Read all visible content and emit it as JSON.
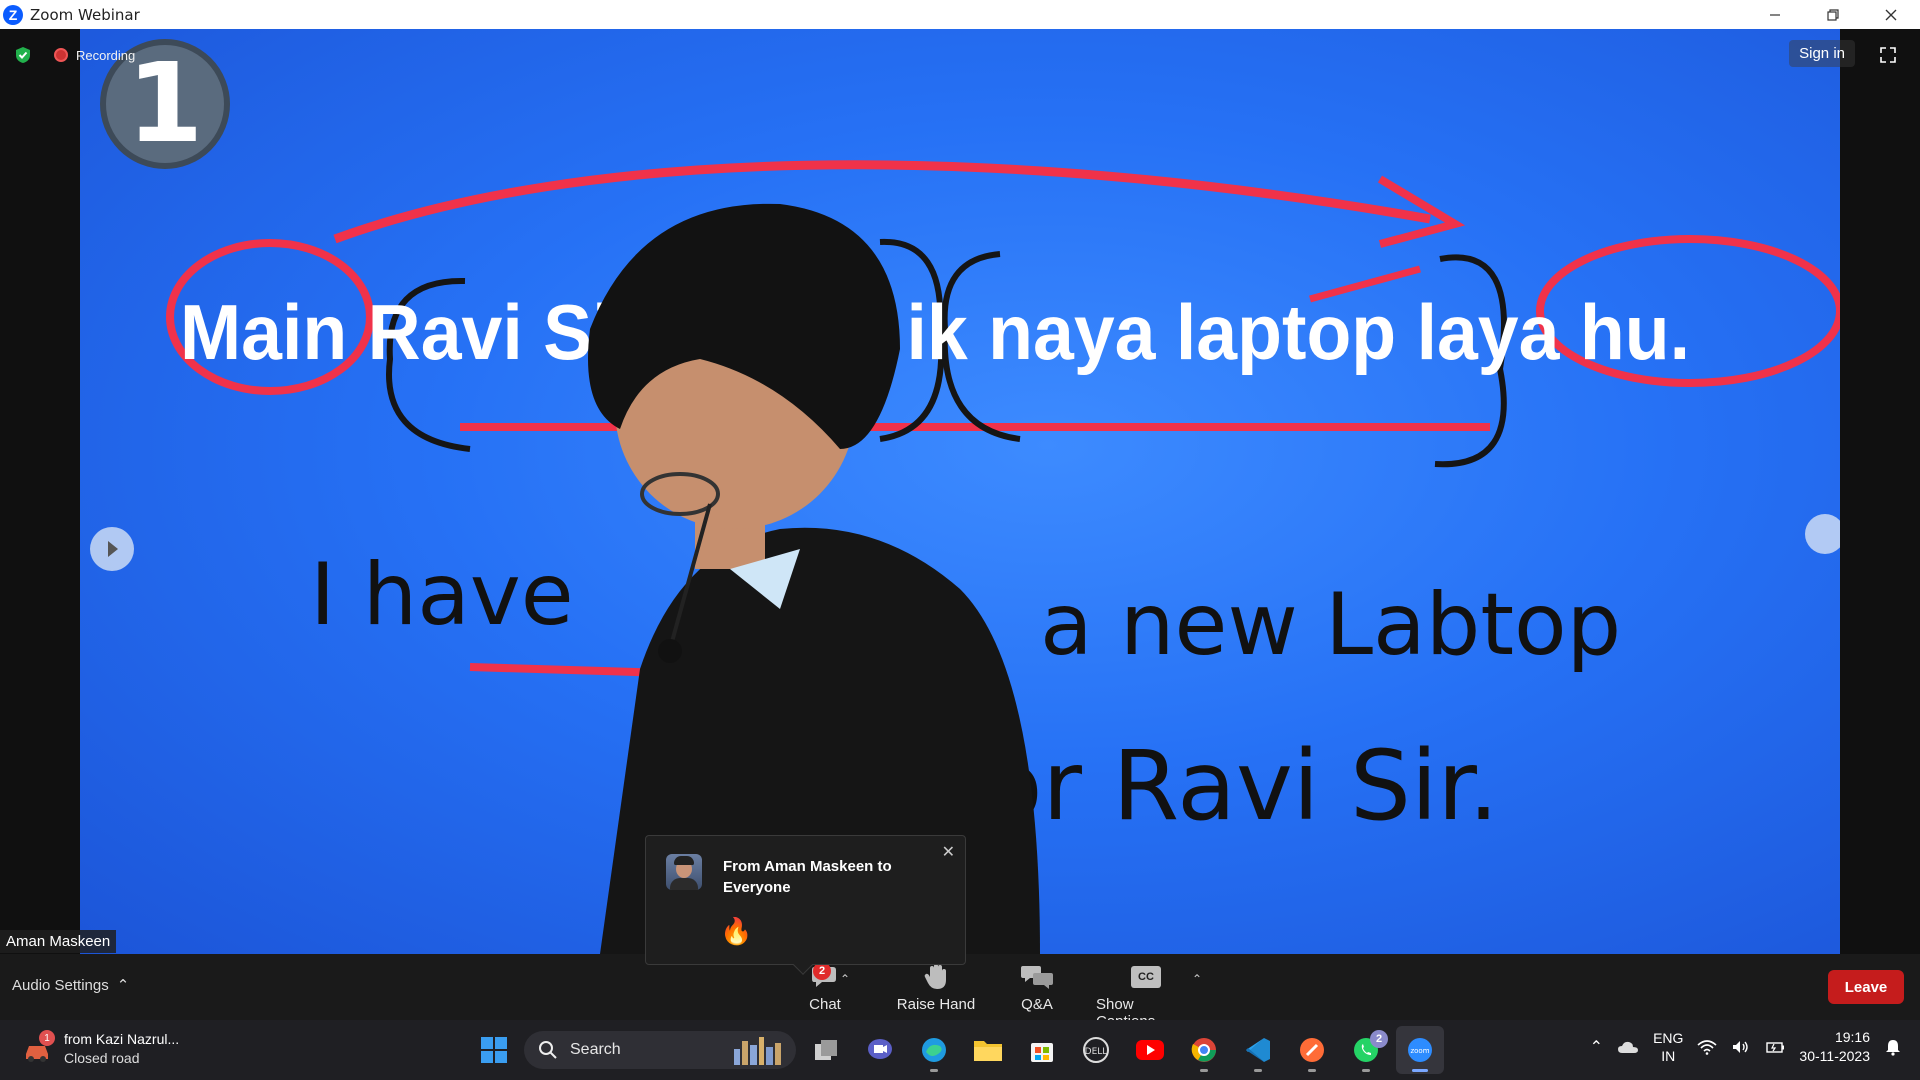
{
  "window": {
    "title": "Zoom Webinar",
    "logo_letter": "Z"
  },
  "meeting": {
    "recording_label": "Recording",
    "sign_in_label": "Sign in",
    "speaker_name": "Aman Maskeen",
    "board": {
      "badge_number": "1",
      "printed_sentence": "Main Ravi Sir ke liye ik naya laptop laya hu.",
      "handwritten_line1": "I have",
      "handwritten_line2": "a new Labtop",
      "handwritten_line3": "for Ravi Sir."
    }
  },
  "chat_toast": {
    "title": "From Aman Maskeen to Everyone",
    "message": "🔥",
    "close_icon": "close-icon"
  },
  "toolbar": {
    "audio_settings": "Audio Settings",
    "chat_label": "Chat",
    "chat_badge": "2",
    "raise_hand_label": "Raise Hand",
    "qa_label": "Q&A",
    "captions_label": "Show Captions",
    "cc_text": "CC",
    "leave_label": "Leave",
    "leave_color": "#c51c1c"
  },
  "taskbar": {
    "notification": {
      "badge": "1",
      "line1": "from Kazi Nazrul...",
      "line2": "Closed road"
    },
    "search_label": "Search",
    "apps": [
      "task-view-icon",
      "meet-icon",
      "edge-icon",
      "file-explorer-icon",
      "store-icon",
      "dell-icon",
      "youtube-icon",
      "chrome-icon",
      "vscode-icon",
      "postman-icon",
      "whatsapp-icon",
      "zoom-icon"
    ],
    "whatsapp_badge": "2",
    "language_line1": "ENG",
    "language_line2": "IN",
    "time": "19:16",
    "date": "30-11-2023"
  }
}
